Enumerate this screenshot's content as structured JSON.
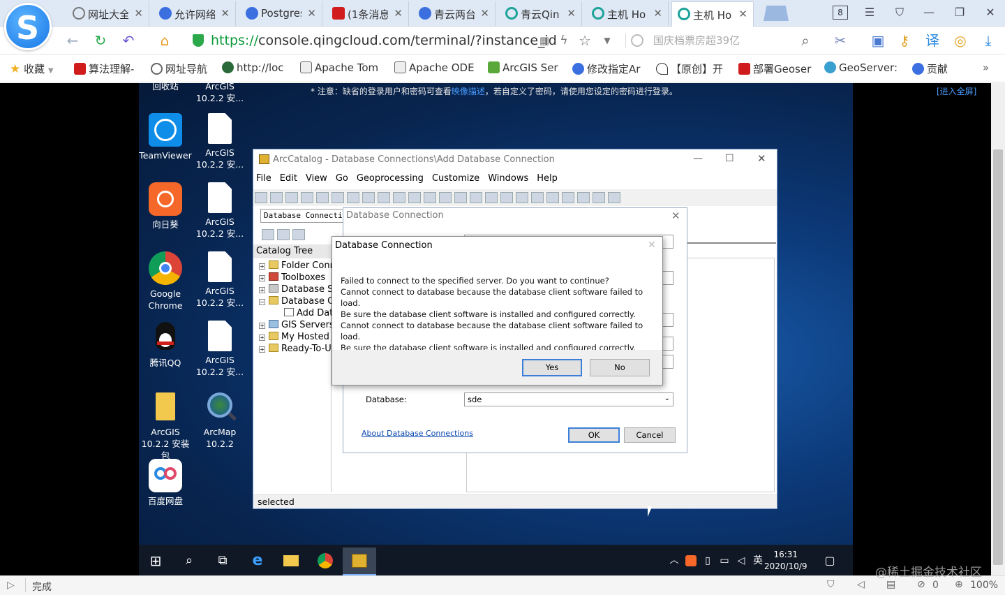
{
  "browser": {
    "tabs": [
      {
        "label": "网址大全",
        "icon_color": "#7a7a7a"
      },
      {
        "label": "允许网络",
        "icon_color": "#3b6fe0"
      },
      {
        "label": "Postgres",
        "icon_color": "#3b6fe0"
      },
      {
        "label": "(1条消息",
        "icon_color": "#d01c1c"
      },
      {
        "label": "青云两台",
        "icon_color": "#3b6fe0"
      },
      {
        "label": "青云Qin",
        "icon_color": "#1ea39a"
      },
      {
        "label": "主机 Ho",
        "icon_color": "#1ea39a"
      },
      {
        "label": "主机 Ho",
        "icon_color": "#1ea39a"
      }
    ],
    "tab_count": "8",
    "url_scheme": "https://",
    "url_host": "console.qingcloud.com",
    "url_path": "/terminal/?instance_id",
    "search_placeholder": "国庆档票房超39亿",
    "bookmarks": [
      {
        "label": "收藏"
      },
      {
        "label": "算法理解-"
      },
      {
        "label": "网址导航"
      },
      {
        "label": "http://loc"
      },
      {
        "label": "Apache Tom"
      },
      {
        "label": "Apache ODE"
      },
      {
        "label": "ArcGIS Ser"
      },
      {
        "label": "修改指定Ar"
      },
      {
        "label": "【原创】开"
      },
      {
        "label": "部署Geoser"
      },
      {
        "label": "GeoServer:"
      },
      {
        "label": "贡献"
      }
    ],
    "status_text": "完成",
    "zoom": "100%",
    "counter": "0",
    "watermark": "@稀土掘金技术社区"
  },
  "console": {
    "notice_prefix": "* 注意：缺省的登录用户和密码可查看",
    "notice_link": "映像描述",
    "notice_suffix": "，若自定义了密码，请使用您设定的密码进行登录。",
    "fullscreen": "[进入全屏]"
  },
  "desktop": {
    "icons_col1": [
      {
        "label": "回收站"
      },
      {
        "label": "TeamViewer"
      },
      {
        "label": "向日葵"
      },
      {
        "label": "Google Chrome"
      },
      {
        "label": "腾讯QQ"
      },
      {
        "label": "ArcGIS 10.2.2 安装包"
      },
      {
        "label": "百度网盘"
      }
    ],
    "icons_col2": [
      {
        "label": "ArcGIS 10.2.2 安..."
      },
      {
        "label": "ArcGIS 10.2.2 安..."
      },
      {
        "label": "ArcGIS 10.2.2 安..."
      },
      {
        "label": "ArcGIS 10.2.2 安..."
      },
      {
        "label": "ArcGIS 10.2.2 安..."
      },
      {
        "label": "ArcMap 10.2.2"
      }
    ],
    "clock_time": "16:31",
    "clock_date": "2020/10/9",
    "ime": "英"
  },
  "arccatalog": {
    "title": "ArcCatalog - Database Connections\\Add Database Connection",
    "menu": [
      "File",
      "Edit",
      "View",
      "Go",
      "Geoprocessing",
      "Customize",
      "Windows",
      "Help"
    ],
    "location_value": "Database Connections",
    "catalog_tree_title": "Catalog Tree",
    "tree": [
      {
        "label": "Folder Connections",
        "expand": "+"
      },
      {
        "label": "Toolboxes",
        "expand": "+"
      },
      {
        "label": "Database Servers",
        "expand": "+"
      },
      {
        "label": "Database Connections",
        "expand": "−"
      },
      {
        "label": "Add Database Connection",
        "expand": ""
      },
      {
        "label": "GIS Servers",
        "expand": "+"
      },
      {
        "label": "My Hosted Services",
        "expand": "+"
      },
      {
        "label": "Ready-To-Use Services",
        "expand": "+"
      }
    ],
    "status": "selected"
  },
  "db_dialog": {
    "title": "Database Connection",
    "database_label": "Database:",
    "database_value": "sde",
    "about_link": "About Database Connections",
    "ok": "OK",
    "cancel": "Cancel"
  },
  "message_box": {
    "title": "Database Connection",
    "lines": [
      "Failed to connect to the specified server. Do you want to continue?",
      "Cannot connect to database because the database client software failed to load.",
      "Be sure the database client software is installed and configured correctly.",
      "Cannot connect to database because the database client software failed to load.",
      "Be sure the database client software is installed and configured correctly."
    ],
    "yes": "Yes",
    "no": "No"
  }
}
